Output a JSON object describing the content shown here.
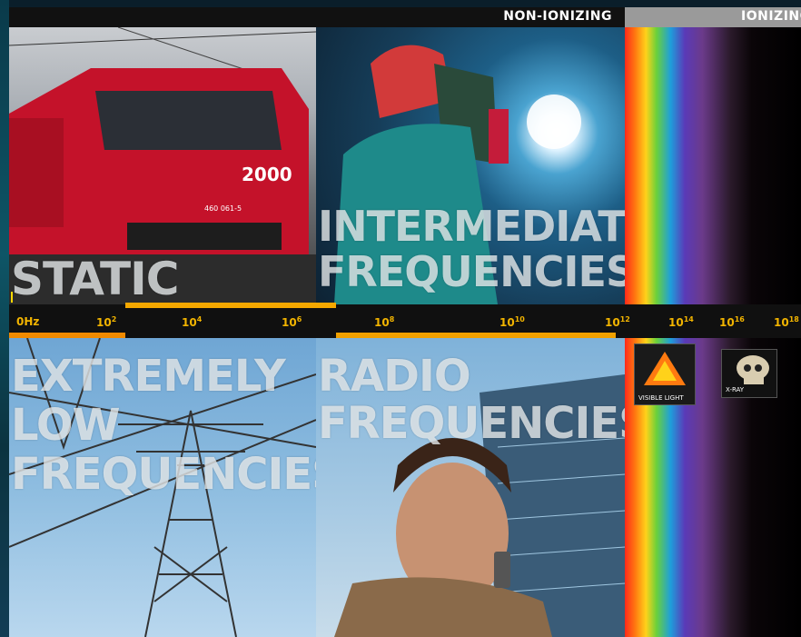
{
  "header": {
    "non_ionizing": "NON-IONIZING",
    "ionizing": "IONIZING"
  },
  "panels": {
    "static": {
      "title": "STATIC",
      "train_number": "2000",
      "train_plate": "460 061-5"
    },
    "intermediate": {
      "title_line1": "INTERMEDIATE",
      "title_line2": "FREQUENCIES"
    },
    "elf": {
      "title_line1": "EXTREMELY",
      "title_line2": "LOW",
      "title_line3": "FREQUENCIES"
    },
    "radio": {
      "title_line1": "RADIO",
      "title_line2": "FREQUENCIES"
    }
  },
  "axis": {
    "ticks": [
      {
        "base": "0Hz",
        "exp": ""
      },
      {
        "base": "10",
        "exp": "2"
      },
      {
        "base": "10",
        "exp": "4"
      },
      {
        "base": "10",
        "exp": "6"
      },
      {
        "base": "10",
        "exp": "8"
      },
      {
        "base": "10",
        "exp": "10"
      },
      {
        "base": "10",
        "exp": "12"
      },
      {
        "base": "10",
        "exp": "14"
      },
      {
        "base": "10",
        "exp": "16"
      },
      {
        "base": "10",
        "exp": "18"
      }
    ]
  },
  "tiles": {
    "visible_light": "VISIBLE LIGHT",
    "xray": "X-RAY"
  },
  "colors": {
    "tick_color": "#f2b400",
    "band_orange": "#f08a00",
    "band_yellow": "#ffd800",
    "ionizing_header": "#9a9a9a"
  }
}
